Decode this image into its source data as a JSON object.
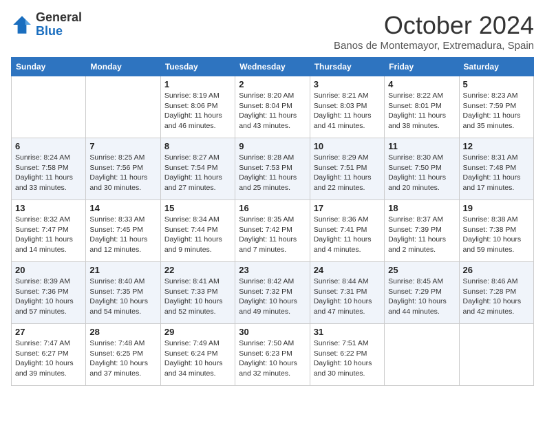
{
  "logo": {
    "general": "General",
    "blue": "Blue"
  },
  "title": "October 2024",
  "subtitle": "Banos de Montemayor, Extremadura, Spain",
  "days_of_week": [
    "Sunday",
    "Monday",
    "Tuesday",
    "Wednesday",
    "Thursday",
    "Friday",
    "Saturday"
  ],
  "weeks": [
    [
      {
        "day": "",
        "info": ""
      },
      {
        "day": "",
        "info": ""
      },
      {
        "day": "1",
        "info": "Sunrise: 8:19 AM\nSunset: 8:06 PM\nDaylight: 11 hours and 46 minutes."
      },
      {
        "day": "2",
        "info": "Sunrise: 8:20 AM\nSunset: 8:04 PM\nDaylight: 11 hours and 43 minutes."
      },
      {
        "day": "3",
        "info": "Sunrise: 8:21 AM\nSunset: 8:03 PM\nDaylight: 11 hours and 41 minutes."
      },
      {
        "day": "4",
        "info": "Sunrise: 8:22 AM\nSunset: 8:01 PM\nDaylight: 11 hours and 38 minutes."
      },
      {
        "day": "5",
        "info": "Sunrise: 8:23 AM\nSunset: 7:59 PM\nDaylight: 11 hours and 35 minutes."
      }
    ],
    [
      {
        "day": "6",
        "info": "Sunrise: 8:24 AM\nSunset: 7:58 PM\nDaylight: 11 hours and 33 minutes."
      },
      {
        "day": "7",
        "info": "Sunrise: 8:25 AM\nSunset: 7:56 PM\nDaylight: 11 hours and 30 minutes."
      },
      {
        "day": "8",
        "info": "Sunrise: 8:27 AM\nSunset: 7:54 PM\nDaylight: 11 hours and 27 minutes."
      },
      {
        "day": "9",
        "info": "Sunrise: 8:28 AM\nSunset: 7:53 PM\nDaylight: 11 hours and 25 minutes."
      },
      {
        "day": "10",
        "info": "Sunrise: 8:29 AM\nSunset: 7:51 PM\nDaylight: 11 hours and 22 minutes."
      },
      {
        "day": "11",
        "info": "Sunrise: 8:30 AM\nSunset: 7:50 PM\nDaylight: 11 hours and 20 minutes."
      },
      {
        "day": "12",
        "info": "Sunrise: 8:31 AM\nSunset: 7:48 PM\nDaylight: 11 hours and 17 minutes."
      }
    ],
    [
      {
        "day": "13",
        "info": "Sunrise: 8:32 AM\nSunset: 7:47 PM\nDaylight: 11 hours and 14 minutes."
      },
      {
        "day": "14",
        "info": "Sunrise: 8:33 AM\nSunset: 7:45 PM\nDaylight: 11 hours and 12 minutes."
      },
      {
        "day": "15",
        "info": "Sunrise: 8:34 AM\nSunset: 7:44 PM\nDaylight: 11 hours and 9 minutes."
      },
      {
        "day": "16",
        "info": "Sunrise: 8:35 AM\nSunset: 7:42 PM\nDaylight: 11 hours and 7 minutes."
      },
      {
        "day": "17",
        "info": "Sunrise: 8:36 AM\nSunset: 7:41 PM\nDaylight: 11 hours and 4 minutes."
      },
      {
        "day": "18",
        "info": "Sunrise: 8:37 AM\nSunset: 7:39 PM\nDaylight: 11 hours and 2 minutes."
      },
      {
        "day": "19",
        "info": "Sunrise: 8:38 AM\nSunset: 7:38 PM\nDaylight: 10 hours and 59 minutes."
      }
    ],
    [
      {
        "day": "20",
        "info": "Sunrise: 8:39 AM\nSunset: 7:36 PM\nDaylight: 10 hours and 57 minutes."
      },
      {
        "day": "21",
        "info": "Sunrise: 8:40 AM\nSunset: 7:35 PM\nDaylight: 10 hours and 54 minutes."
      },
      {
        "day": "22",
        "info": "Sunrise: 8:41 AM\nSunset: 7:33 PM\nDaylight: 10 hours and 52 minutes."
      },
      {
        "day": "23",
        "info": "Sunrise: 8:42 AM\nSunset: 7:32 PM\nDaylight: 10 hours and 49 minutes."
      },
      {
        "day": "24",
        "info": "Sunrise: 8:44 AM\nSunset: 7:31 PM\nDaylight: 10 hours and 47 minutes."
      },
      {
        "day": "25",
        "info": "Sunrise: 8:45 AM\nSunset: 7:29 PM\nDaylight: 10 hours and 44 minutes."
      },
      {
        "day": "26",
        "info": "Sunrise: 8:46 AM\nSunset: 7:28 PM\nDaylight: 10 hours and 42 minutes."
      }
    ],
    [
      {
        "day": "27",
        "info": "Sunrise: 7:47 AM\nSunset: 6:27 PM\nDaylight: 10 hours and 39 minutes."
      },
      {
        "day": "28",
        "info": "Sunrise: 7:48 AM\nSunset: 6:25 PM\nDaylight: 10 hours and 37 minutes."
      },
      {
        "day": "29",
        "info": "Sunrise: 7:49 AM\nSunset: 6:24 PM\nDaylight: 10 hours and 34 minutes."
      },
      {
        "day": "30",
        "info": "Sunrise: 7:50 AM\nSunset: 6:23 PM\nDaylight: 10 hours and 32 minutes."
      },
      {
        "day": "31",
        "info": "Sunrise: 7:51 AM\nSunset: 6:22 PM\nDaylight: 10 hours and 30 minutes."
      },
      {
        "day": "",
        "info": ""
      },
      {
        "day": "",
        "info": ""
      }
    ]
  ]
}
